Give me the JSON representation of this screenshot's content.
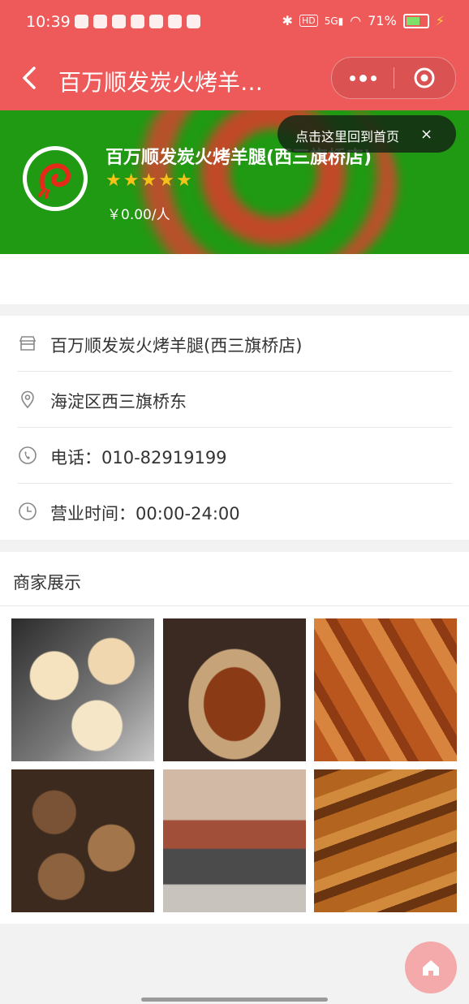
{
  "status_bar": {
    "time": "10:39",
    "battery": "71%",
    "icons_left": [
      "heart-icon",
      "chat-icon",
      "alipay-icon",
      "toutiao-icon",
      "app-icon",
      "redbook-icon",
      "bird-icon"
    ],
    "icons_right": [
      "bluetooth-icon",
      "hd-icon",
      "signal-5g-icon",
      "wifi-icon",
      "battery-icon",
      "charging-icon"
    ]
  },
  "navbar": {
    "title": "百万顺发炭火烤羊…",
    "back_icon": "chevron-left-icon",
    "more_icon": "more-dots-icon",
    "close_icon": "target-icon"
  },
  "toast": {
    "text": "点击这里回到首页",
    "close": "×"
  },
  "shop": {
    "name": "百万顺发炭火烤羊腿(西三旗桥店)",
    "rating": 5,
    "price": "￥0.00/人"
  },
  "info": {
    "items": [
      {
        "icon": "store-icon",
        "text": "百万顺发炭火烤羊腿(西三旗桥店)"
      },
      {
        "icon": "location-icon",
        "text": "海淀区西三旗桥东"
      },
      {
        "icon": "phone-icon",
        "text": "电话：010-82919199"
      },
      {
        "icon": "clock-icon",
        "text": "营业时间：00:00-24:00"
      }
    ]
  },
  "display": {
    "title": "商家展示",
    "photos": [
      "grilled-scallops",
      "lamb-skewers",
      "chicken-wings",
      "braised-lamb",
      "roast-lamb-on-charcoal",
      "grilled-lamb-leg"
    ]
  },
  "colors": {
    "navbar": "#ee5a5a",
    "banner": "#1f9a12",
    "star": "#f6c21a",
    "fab": "#f4aaaa"
  }
}
